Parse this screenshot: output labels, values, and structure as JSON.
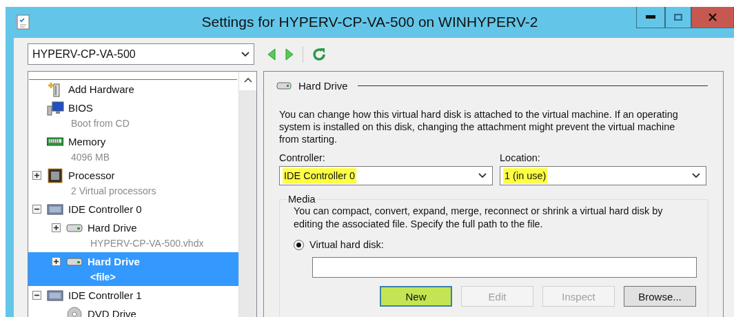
{
  "window": {
    "title": "Settings for HYPERV-CP-VA-500 on WINHYPERV-2"
  },
  "vm_selector": {
    "value": "HYPERV-CP-VA-500"
  },
  "tree": [
    {
      "kind": "add",
      "label": "Add Hardware",
      "selected": false
    },
    {
      "kind": "bios",
      "label": "BIOS",
      "detail": "Boot from CD",
      "selected": false
    },
    {
      "kind": "memory",
      "label": "Memory",
      "detail": "4096 MB",
      "selected": false
    },
    {
      "kind": "processor",
      "label": "Processor",
      "detail": "2 Virtual processors",
      "expanded": false,
      "selected": false
    },
    {
      "kind": "controller",
      "label": "IDE Controller 0",
      "expanded": true,
      "selected": false,
      "children": [
        {
          "kind": "disk",
          "label": "Hard Drive",
          "detail": "HYPERV-CP-VA-500.vhdx",
          "expanded": false,
          "selected": false
        },
        {
          "kind": "disk",
          "label": "Hard Drive",
          "detail": "<file>",
          "expanded": false,
          "selected": true
        }
      ]
    },
    {
      "kind": "controller",
      "label": "IDE Controller 1",
      "expanded": true,
      "selected": false,
      "children": [
        {
          "kind": "dvd",
          "label": "DVD Drive",
          "selected": false
        }
      ]
    }
  ],
  "detail": {
    "heading": "Hard Drive",
    "description": "You can change how this virtual hard disk is attached to the virtual machine. If an operating system is installed on this disk, changing the attachment might prevent the virtual machine from starting.",
    "selects": [
      {
        "label": "Controller:",
        "value": "IDE Controller 0",
        "highlighted": true
      },
      {
        "label": "Location:",
        "value": "1 (in use)",
        "highlighted": true
      }
    ],
    "media": {
      "legend": "Media",
      "description": "You can compact, convert, expand, merge, reconnect or shrink a virtual hard disk by editing the associated file. Specify the full path to the file.",
      "options": [
        {
          "label": "Virtual hard disk:",
          "selected": true
        }
      ],
      "buttons": [
        {
          "label": "New",
          "disabled": false,
          "highlighted": true
        },
        {
          "label": "Edit",
          "disabled": true,
          "highlighted": false
        },
        {
          "label": "Inspect",
          "disabled": true,
          "highlighted": false
        },
        {
          "label": "Browse...",
          "disabled": false,
          "highlighted": false
        }
      ]
    }
  }
}
